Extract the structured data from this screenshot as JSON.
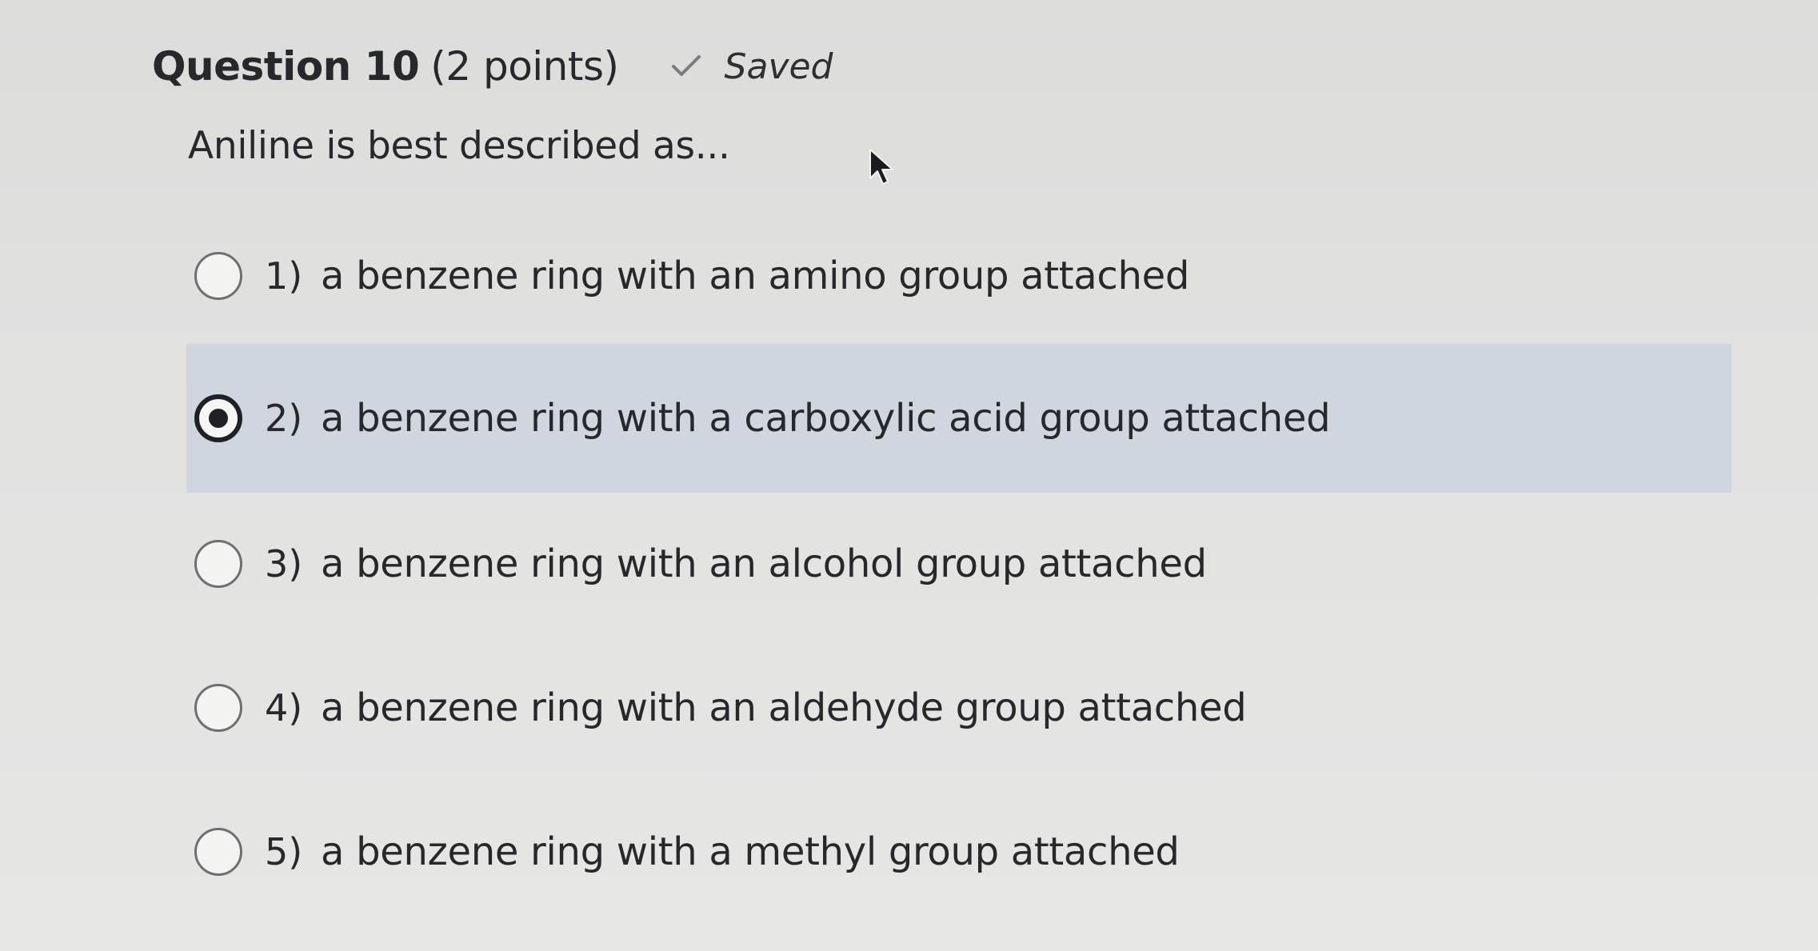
{
  "question": {
    "title": "Question 10",
    "points": "(2 points)",
    "status": "Saved",
    "status_icon": "check-icon",
    "prompt": "Aniline is best described as..."
  },
  "options": [
    {
      "number": "1)",
      "text": "a benzene ring with an amino group attached",
      "selected": false
    },
    {
      "number": "2)",
      "text": "a benzene ring with a carboxylic acid group attached",
      "selected": true
    },
    {
      "number": "3)",
      "text": "a benzene ring with an alcohol group attached",
      "selected": false
    },
    {
      "number": "4)",
      "text": "a benzene ring with an aldehyde group attached",
      "selected": false
    },
    {
      "number": "5)",
      "text": "a benzene ring with a methyl group attached",
      "selected": false
    }
  ],
  "colors": {
    "background": "#e1e1e0",
    "selected_row": "#cfd6de",
    "text": "#26282c"
  }
}
